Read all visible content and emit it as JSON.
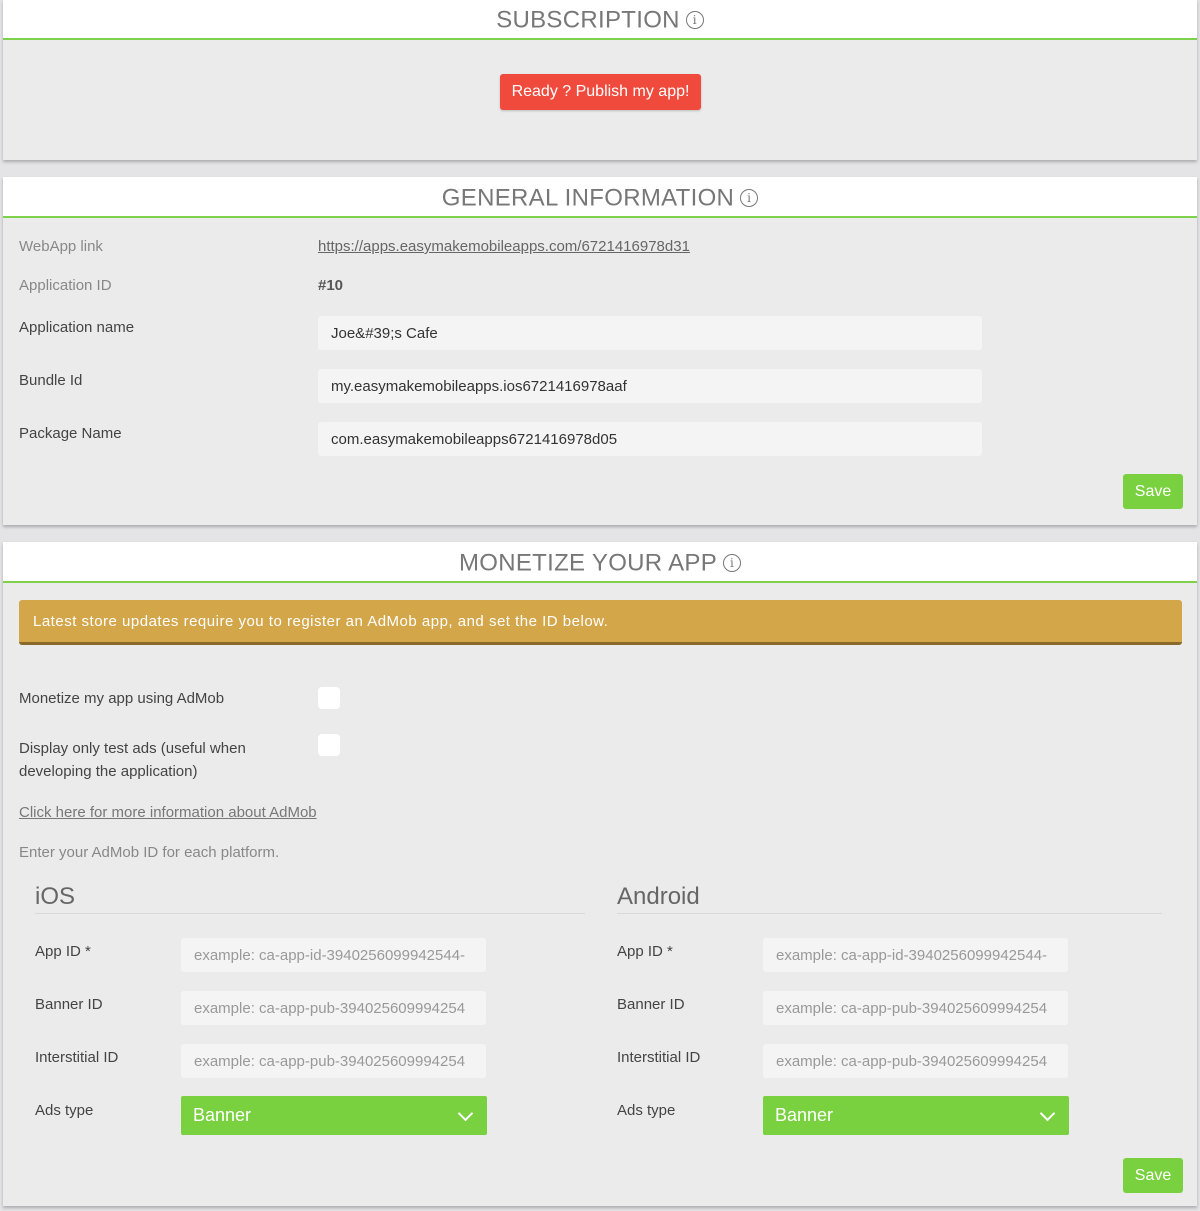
{
  "subscription": {
    "title": "SUBSCRIPTION",
    "publish_button": "Ready ? Publish my app!"
  },
  "general": {
    "title": "GENERAL INFORMATION",
    "webapp_label": "WebApp link",
    "webapp_url": "https://apps.easymakemobileapps.com/6721416978d31",
    "appid_label": "Application ID",
    "appid_value": "#10",
    "appname_label": "Application name",
    "appname_value": "Joe&#39;s Cafe",
    "bundle_label": "Bundle Id",
    "bundle_value": "my.easymakemobileapps.ios6721416978aaf",
    "package_label": "Package Name",
    "package_value": "com.easymakemobileapps6721416978d05",
    "save_label": "Save"
  },
  "monetize": {
    "title": "MONETIZE YOUR APP",
    "alert_text": "Latest store updates require you to register an AdMob app, and set the ID below.",
    "admob_label": "Monetize my app using AdMob",
    "testads_label_line1": "Display only test ads (useful when",
    "testads_label_line2": "developing the application)",
    "info_link": "Click here for more information about AdMob",
    "instruction": "Enter your AdMob ID for each platform.",
    "ios": {
      "title": "iOS",
      "appid_label": "App ID *",
      "appid_placeholder": "example: ca-app-id-3940256099942544-",
      "banner_label": "Banner ID",
      "banner_placeholder": "example: ca-app-pub-394025609994254",
      "interstitial_label": "Interstitial ID",
      "interstitial_placeholder": "example: ca-app-pub-394025609994254",
      "adstype_label": "Ads type",
      "adstype_value": "Banner"
    },
    "android": {
      "title": "Android",
      "appid_label": "App ID *",
      "appid_placeholder": "example: ca-app-id-3940256099942544-",
      "banner_label": "Banner ID",
      "banner_placeholder": "example: ca-app-pub-394025609994254",
      "interstitial_label": "Interstitial ID",
      "interstitial_placeholder": "example: ca-app-pub-394025609994254",
      "adstype_label": "Ads type",
      "adstype_value": "Banner"
    },
    "save_label": "Save"
  },
  "colors": {
    "accent_green": "#7ad13f",
    "publish_red": "#ef4a3c",
    "alert_gold": "#d4a64a"
  }
}
